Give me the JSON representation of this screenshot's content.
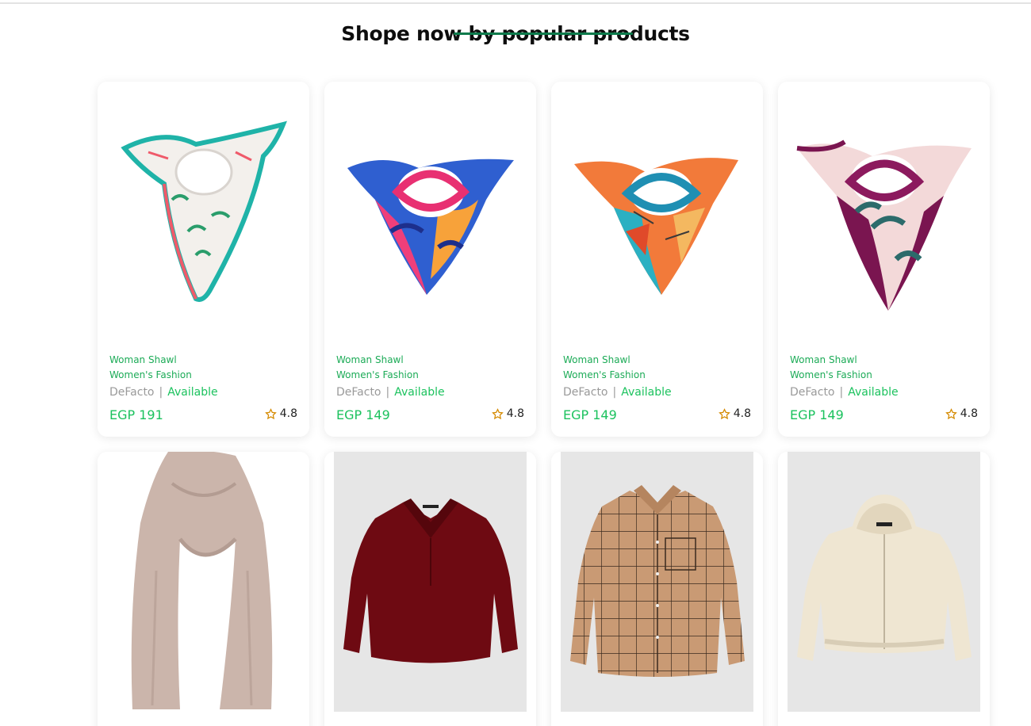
{
  "section": {
    "title": "Shope now by popular products"
  },
  "colors": {
    "accent": "#1cc25e",
    "underline": "#0b7a4b",
    "category": "#1cab57",
    "brand_text": "#9a9a9a"
  },
  "products": [
    {
      "image": "scarf-white-floral",
      "name": "Woman Shawl",
      "category": "Women's Fashion",
      "brand": "DeFacto",
      "status": "Available",
      "price": "EGP 191",
      "rating": "4.8"
    },
    {
      "image": "scarf-blue-pink",
      "name": "Woman Shawl",
      "category": "Women's Fashion",
      "brand": "DeFacto",
      "status": "Available",
      "price": "EGP 149",
      "rating": "4.8"
    },
    {
      "image": "scarf-orange-geometric",
      "name": "Woman Shawl",
      "category": "Women's Fashion",
      "brand": "DeFacto",
      "status": "Available",
      "price": "EGP 149",
      "rating": "4.8"
    },
    {
      "image": "scarf-plum-leaves",
      "name": "Woman Shawl",
      "category": "Women's Fashion",
      "brand": "DeFacto",
      "status": "Available",
      "price": "EGP 149",
      "rating": "4.8"
    },
    {
      "image": "scarf-beige-long"
    },
    {
      "image": "blouse-burgundy"
    },
    {
      "image": "shirt-beige-check"
    },
    {
      "image": "hoodie-cream-zip"
    }
  ],
  "separator": "|"
}
